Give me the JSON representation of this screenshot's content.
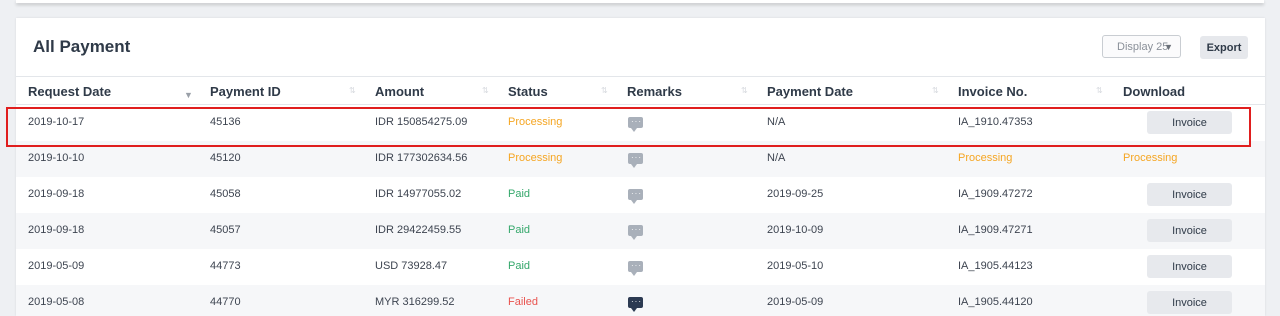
{
  "page": {
    "title": "All Payment",
    "display_select": "Display 25",
    "export_label": "Export"
  },
  "table": {
    "columns": [
      "Request Date",
      "Payment ID",
      "Amount",
      "Status",
      "Remarks",
      "Payment Date",
      "Invoice No.",
      "Download"
    ],
    "rows": [
      {
        "request_date": "2019-10-17",
        "payment_id": "45136",
        "amount": "IDR 150854275.09",
        "status": "Processing",
        "payment_date": "N/A",
        "invoice_no": "IA_1910.47353",
        "download": "Invoice"
      },
      {
        "request_date": "2019-10-10",
        "payment_id": "45120",
        "amount": "IDR 177302634.56",
        "status": "Processing",
        "payment_date": "N/A",
        "invoice_no": "Processing",
        "download": "Processing"
      },
      {
        "request_date": "2019-09-18",
        "payment_id": "45058",
        "amount": "IDR 14977055.02",
        "status": "Paid",
        "payment_date": "2019-09-25",
        "invoice_no": "IA_1909.47272",
        "download": "Invoice"
      },
      {
        "request_date": "2019-09-18",
        "payment_id": "45057",
        "amount": "IDR 29422459.55",
        "status": "Paid",
        "payment_date": "2019-10-09",
        "invoice_no": "IA_1909.47271",
        "download": "Invoice"
      },
      {
        "request_date": "2019-05-09",
        "payment_id": "44773",
        "amount": "USD 73928.47",
        "status": "Paid",
        "payment_date": "2019-05-10",
        "invoice_no": "IA_1905.44123",
        "download": "Invoice"
      },
      {
        "request_date": "2019-05-08",
        "payment_id": "44770",
        "amount": "MYR 316299.52",
        "status": "Failed",
        "payment_date": "2019-05-09",
        "invoice_no": "IA_1905.44120",
        "download": "Invoice"
      }
    ]
  },
  "colors": {
    "processing": "#f5a623",
    "paid": "#36a86c",
    "failed": "#e9534f",
    "highlight": "#e01e1e"
  },
  "icons": {
    "remarks": "chat-bubble-icon",
    "sort": "sort-arrows-icon",
    "select_caret": "caret-down-icon"
  }
}
